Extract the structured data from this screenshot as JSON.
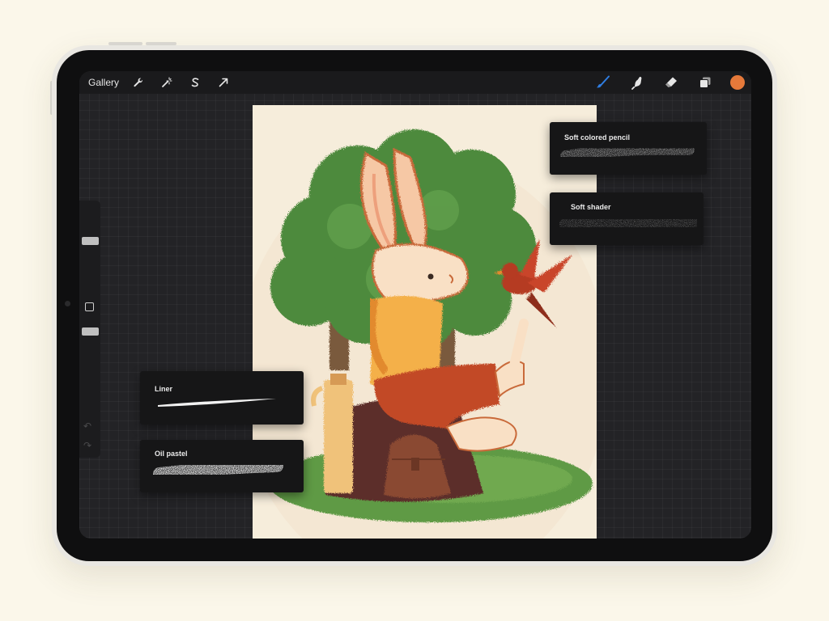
{
  "toolbar": {
    "gallery_label": "Gallery",
    "left_tools": [
      {
        "name": "wrench-icon",
        "title": "Actions"
      },
      {
        "name": "magic-wand-icon",
        "title": "Adjustments"
      },
      {
        "name": "selection-icon",
        "title": "Selection"
      },
      {
        "name": "transform-arrow-icon",
        "title": "Transform"
      }
    ],
    "right_tools": [
      {
        "name": "brush-icon",
        "title": "Paint",
        "active": true
      },
      {
        "name": "smudge-icon",
        "title": "Smudge"
      },
      {
        "name": "eraser-icon",
        "title": "Erase"
      },
      {
        "name": "layers-icon",
        "title": "Layers"
      }
    ],
    "active_color": "#e5793a",
    "active_tool_color": "#2f7de1"
  },
  "brushes": [
    {
      "id": "soft-colored-pencil",
      "name": "Soft colored pencil"
    },
    {
      "id": "soft-shader",
      "name": "Soft shader"
    },
    {
      "id": "liner",
      "name": "Liner"
    },
    {
      "id": "oil-pastel",
      "name": "Oil pastel"
    }
  ],
  "colors": {
    "page_background": "#fbf7ea",
    "interface_dark": "#1a1a1c",
    "canvas_paper": "#f6eddb"
  }
}
